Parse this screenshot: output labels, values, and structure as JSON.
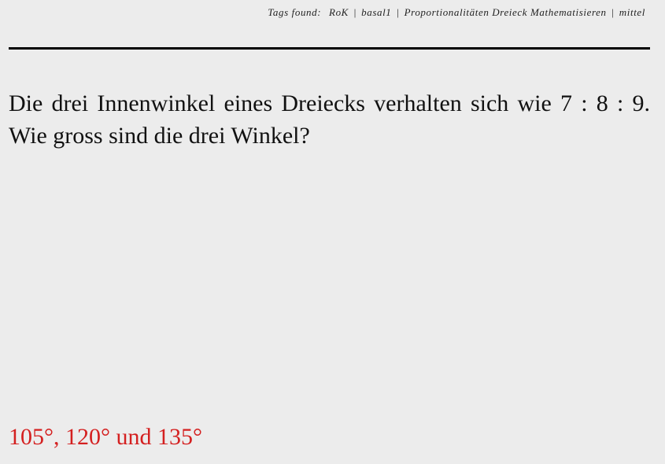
{
  "header": {
    "tags_label": "Tags found:",
    "tags": [
      "RoK",
      "basal1",
      "Proportionalitäten Dreieck Mathematisieren",
      "mittel"
    ],
    "separator": "|"
  },
  "question": {
    "text": "Die drei Innenwinkel eines Dreiecks verhalten sich wie 7 : 8 : 9. Wie gross sind die drei Winkel?"
  },
  "answer": {
    "text": "105°, 120° und 135°",
    "color": "#d42020"
  }
}
